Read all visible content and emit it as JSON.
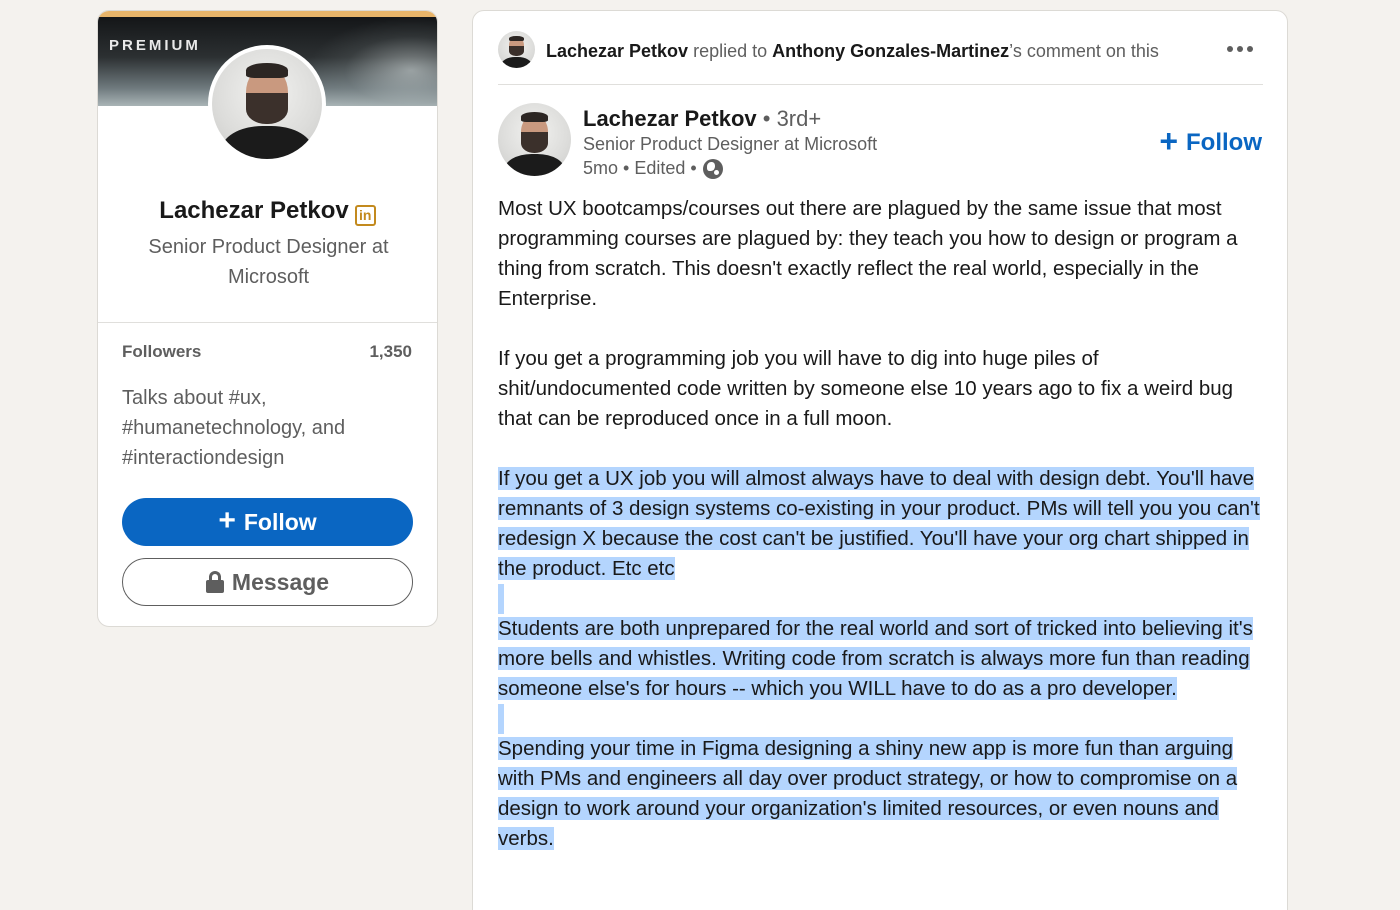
{
  "profile": {
    "premium_label": "PREMIUM",
    "name": "Lachezar Petkov",
    "badge_label": "in",
    "headline": "Senior Product Designer at Microsoft",
    "followers_label": "Followers",
    "followers_count": "1,350",
    "talks_about": "Talks about #ux, #humanetechnology, and #interactiondesign",
    "follow_label": "Follow",
    "message_label": "Message"
  },
  "activity": {
    "actor": "Lachezar Petkov",
    "action": " replied to ",
    "target": "Anthony Gonzales-Martinez",
    "suffix": "’s comment on this"
  },
  "post": {
    "author_name": "Lachezar Petkov",
    "author_degree": " • 3rd+",
    "author_title": "Senior Product Designer at Microsoft",
    "meta": "5mo • Edited •",
    "follow_label": "Follow",
    "paragraphs": [
      "Most UX bootcamps/courses out there are plagued by the same issue that most programming courses are plagued by: they teach you how to design or program a thing from scratch. This doesn't exactly reflect the real world, especially in the Enterprise.",
      "If you get a programming job you will have to dig into huge piles of shit/undocumented code written by someone else 10 years ago to fix a weird bug that can be reproduced once in a full moon.",
      "If you get a UX job you will almost always have to deal with design debt. You'll have remnants of 3 design systems co-existing in your product. PMs will tell you you can't redesign X because the cost can't be justified. You'll have your org chart shipped in the product. Etc etc",
      "Students are both unprepared for the real world and sort of tricked into believing it's more bells and whistles. Writing code from scratch is always more fun than reading someone else's for hours -- which you WILL have to do as a pro developer.",
      "Spending your time in Figma designing a shiny new app is more fun than arguing with PMs and engineers all day over product strategy, or how to compromise on a design to work around your organization's limited resources, or even nouns and verbs."
    ]
  },
  "colors": {
    "accent": "#0a66c2",
    "selection": "#b4d5fe",
    "premium_gold": "#c38a1e"
  },
  "icons": [
    "plus-icon",
    "lock-icon",
    "more-icon",
    "globe-icon",
    "linkedin-premium-icon"
  ]
}
